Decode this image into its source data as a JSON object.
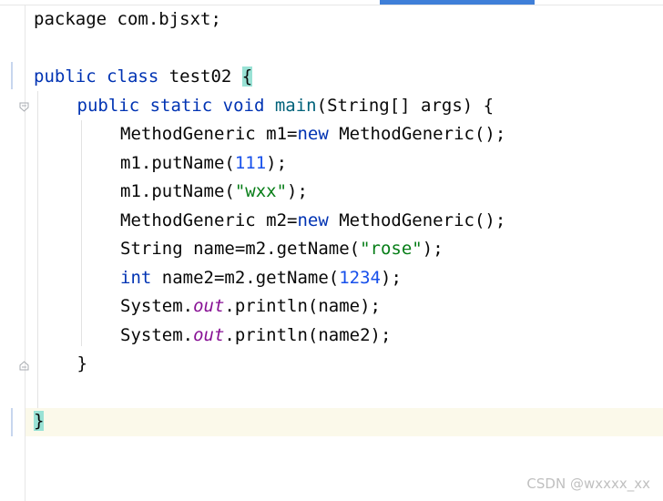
{
  "editor": {
    "lines": [
      {
        "indent": 0,
        "tokens": [
          {
            "t": "package",
            "c": ""
          },
          {
            "t": " com.bjsxt;",
            "c": ""
          }
        ]
      },
      {
        "indent": 0,
        "tokens": []
      },
      {
        "indent": 0,
        "tokens": [
          {
            "t": "public class",
            "c": "kw"
          },
          {
            "t": " test02 ",
            "c": ""
          },
          {
            "t": "{",
            "c": "brace-hl"
          }
        ]
      },
      {
        "indent": 1,
        "tokens": [
          {
            "t": "public static void",
            "c": "kw"
          },
          {
            "t": " ",
            "c": ""
          },
          {
            "t": "main",
            "c": "fn"
          },
          {
            "t": "(String[] args) {",
            "c": ""
          }
        ]
      },
      {
        "indent": 2,
        "tokens": [
          {
            "t": "MethodGeneric m1=",
            "c": ""
          },
          {
            "t": "new",
            "c": "kw"
          },
          {
            "t": " MethodGeneric();",
            "c": ""
          }
        ]
      },
      {
        "indent": 2,
        "tokens": [
          {
            "t": "m1.putName(",
            "c": ""
          },
          {
            "t": "111",
            "c": "num"
          },
          {
            "t": ");",
            "c": ""
          }
        ]
      },
      {
        "indent": 2,
        "tokens": [
          {
            "t": "m1.putName(",
            "c": ""
          },
          {
            "t": "\"wxx\"",
            "c": "str"
          },
          {
            "t": ");",
            "c": ""
          }
        ]
      },
      {
        "indent": 2,
        "tokens": [
          {
            "t": "MethodGeneric m2=",
            "c": ""
          },
          {
            "t": "new",
            "c": "kw"
          },
          {
            "t": " MethodGeneric();",
            "c": ""
          }
        ]
      },
      {
        "indent": 2,
        "tokens": [
          {
            "t": "String name=m2.getName(",
            "c": ""
          },
          {
            "t": "\"rose\"",
            "c": "str"
          },
          {
            "t": ");",
            "c": ""
          }
        ]
      },
      {
        "indent": 2,
        "tokens": [
          {
            "t": "int",
            "c": "kw"
          },
          {
            "t": " name2=m2.getName(",
            "c": ""
          },
          {
            "t": "1234",
            "c": "num"
          },
          {
            "t": ");",
            "c": ""
          }
        ]
      },
      {
        "indent": 2,
        "tokens": [
          {
            "t": "System.",
            "c": ""
          },
          {
            "t": "out",
            "c": "fld"
          },
          {
            "t": ".println(name);",
            "c": ""
          }
        ]
      },
      {
        "indent": 2,
        "tokens": [
          {
            "t": "System.",
            "c": ""
          },
          {
            "t": "out",
            "c": "fld"
          },
          {
            "t": ".println(name2);",
            "c": ""
          }
        ]
      },
      {
        "indent": 1,
        "tokens": [
          {
            "t": "}",
            "c": ""
          }
        ]
      },
      {
        "indent": 0,
        "tokens": []
      },
      {
        "indent": 0,
        "tokens": [
          {
            "t": "}",
            "c": "brace-hl"
          }
        ]
      }
    ]
  },
  "watermark": "CSDN @wxxxx_xx",
  "colors": {
    "keyword": "#0033b3",
    "method": "#00627a",
    "string": "#067d17",
    "number": "#1750eb",
    "static_field": "#871094",
    "brace_highlight": "#99e2d5",
    "current_line": "#fbf9ea",
    "tab_indicator": "#3f7fd8"
  },
  "icons": [
    "fold-start-icon",
    "fold-end-icon"
  ]
}
